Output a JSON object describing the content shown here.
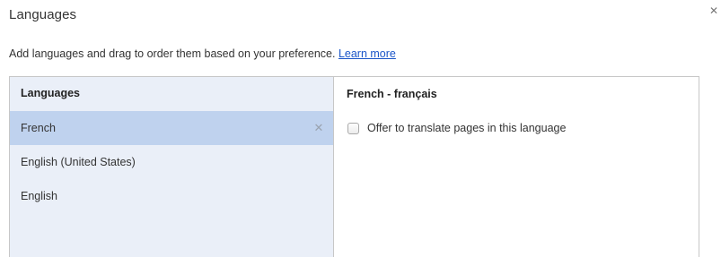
{
  "dialog": {
    "title": "Languages",
    "description": "Add languages and drag to order them based on your preference.",
    "learn_more": "Learn more",
    "close_icon": "close-icon"
  },
  "language_list": {
    "header": "Languages",
    "items": [
      {
        "label": "French",
        "selected": true
      },
      {
        "label": "English (United States)",
        "selected": false
      },
      {
        "label": "English",
        "selected": false
      }
    ],
    "remove_icon": "close-icon"
  },
  "detail": {
    "title": "French - français",
    "translate_label": "Offer to translate pages in this language",
    "translate_checked": false
  },
  "colors": {
    "list_background": "#eaeff8",
    "selected_row": "#bfd2ee",
    "link": "#1a55c8"
  }
}
